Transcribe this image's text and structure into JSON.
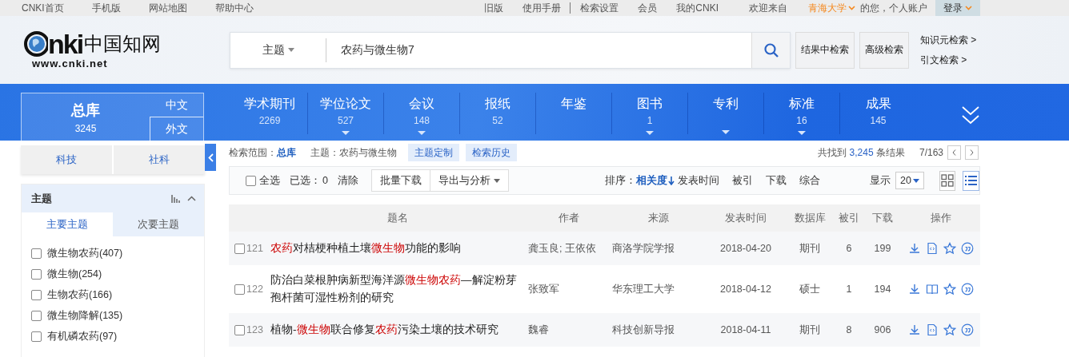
{
  "top_links": [
    "CNKI首页",
    "手机版",
    "网站地图",
    "帮助中心"
  ],
  "top_right": {
    "links": [
      "旧版",
      "使用手册"
    ],
    "links2": [
      "检索设置",
      "会员",
      "我的CNKI"
    ],
    "welcome": "欢迎来自",
    "institution": "青海大学",
    "account": "的您，个人账户",
    "login": "登录"
  },
  "logo": {
    "mark": "nki",
    "name": "中国知网",
    "url": "www.cnki.net"
  },
  "search": {
    "field": "主题",
    "value": "农药与微生物7"
  },
  "search_buttons": [
    "结果中检索",
    "高级检索"
  ],
  "side_links": [
    "知识元检索 >",
    "引文检索 >"
  ],
  "library": {
    "name": "总库",
    "count": "3245",
    "tabs": [
      {
        "label": "中文",
        "selected": false
      },
      {
        "label": "外文",
        "selected": true
      }
    ]
  },
  "nav": [
    {
      "label": "学术期刊",
      "count": "2269",
      "has_menu": false
    },
    {
      "label": "学位论文",
      "count": "527",
      "has_menu": true
    },
    {
      "label": "会议",
      "count": "148",
      "has_menu": true
    },
    {
      "label": "报纸",
      "count": "52",
      "has_menu": false
    },
    {
      "label": "年鉴",
      "has_menu": false
    },
    {
      "label": "图书",
      "count": "1",
      "has_menu": true
    },
    {
      "label": "专利",
      "has_menu": true
    },
    {
      "label": "标准",
      "count": "16",
      "has_menu": true
    },
    {
      "label": "成果",
      "count": "145",
      "has_menu": false
    }
  ],
  "category_tabs": [
    {
      "label": "科技",
      "selected": false
    },
    {
      "label": "社科",
      "selected": false
    }
  ],
  "facet": {
    "title": "主题",
    "tabs": [
      {
        "label": "主要主题",
        "selected": true
      },
      {
        "label": "次要主题",
        "selected": false
      }
    ],
    "items": [
      {
        "label": "微生物农药(407)",
        "checked": false
      },
      {
        "label": "微生物(254)",
        "checked": false
      },
      {
        "label": "生物农药(166)",
        "checked": false
      },
      {
        "label": "微生物降解(135)",
        "checked": false
      },
      {
        "label": "有机磷农药(97)",
        "checked": false
      }
    ]
  },
  "scope": {
    "label": "检索范围：",
    "value": "总库",
    "topic": "主题：农药与微生物",
    "buttons": [
      "主题定制",
      "检索历史"
    ]
  },
  "results": {
    "prefix": "共找到",
    "count": "3,245",
    "suffix": "条结果",
    "page": "7/163"
  },
  "toolbar": {
    "select_all": {
      "label": "全选",
      "checked": false
    },
    "selected_label": "已选：",
    "selected_count": "0",
    "clear": "清除",
    "batch": "批量下载",
    "export": "导出与分析"
  },
  "sort": {
    "label": "排序：",
    "options": [
      {
        "label": "相关度",
        "selected": true
      },
      {
        "label": "发表时间",
        "selected": false
      },
      {
        "label": "被引",
        "selected": false
      },
      {
        "label": "下载",
        "selected": false
      },
      {
        "label": "综合",
        "selected": false
      }
    ]
  },
  "display": {
    "label": "显示",
    "value": "20"
  },
  "views": [
    {
      "kind": "grid",
      "selected": false
    },
    {
      "kind": "list",
      "selected": true
    }
  ],
  "columns": [
    "题名",
    "作者",
    "来源",
    "发表时间",
    "数据库",
    "被引",
    "下载",
    "操作"
  ],
  "rows": [
    {
      "checked": false,
      "number": "121",
      "kind": "journal",
      "title": [
        {
          "text": "农药",
          "hit": true
        },
        {
          "text": "对桔梗种植土壤",
          "hit": false
        },
        {
          "text": "微生物",
          "hit": true
        },
        {
          "text": "功能的影响",
          "hit": false
        }
      ],
      "author": "龚玉良; 王依依",
      "source": "商洛学院学报",
      "date": "2018-04-20",
      "database": "期刊",
      "cited": "6",
      "downloads": "199"
    },
    {
      "checked": false,
      "number": "122",
      "kind": "thesis",
      "title": [
        {
          "text": "防治白菜根肿病新型海洋源",
          "hit": false
        },
        {
          "text": "微生物农药",
          "hit": true
        },
        {
          "text": "—解淀粉芽孢杆菌可湿性粉剂的研究",
          "hit": false
        }
      ],
      "author": "张致军",
      "source": "华东理工大学",
      "date": "2018-04-12",
      "database": "硕士",
      "cited": "1",
      "downloads": "194"
    },
    {
      "checked": false,
      "number": "123",
      "kind": "journal",
      "title": [
        {
          "text": "植物-",
          "hit": false
        },
        {
          "text": "微生物",
          "hit": true
        },
        {
          "text": "联合修复",
          "hit": false
        },
        {
          "text": "农药",
          "hit": true
        },
        {
          "text": "污染土壤的技术研究",
          "hit": false
        }
      ],
      "author": "魏睿",
      "source": "科技创新导报",
      "date": "2018-04-11",
      "database": "期刊",
      "cited": "8",
      "downloads": "906"
    }
  ]
}
